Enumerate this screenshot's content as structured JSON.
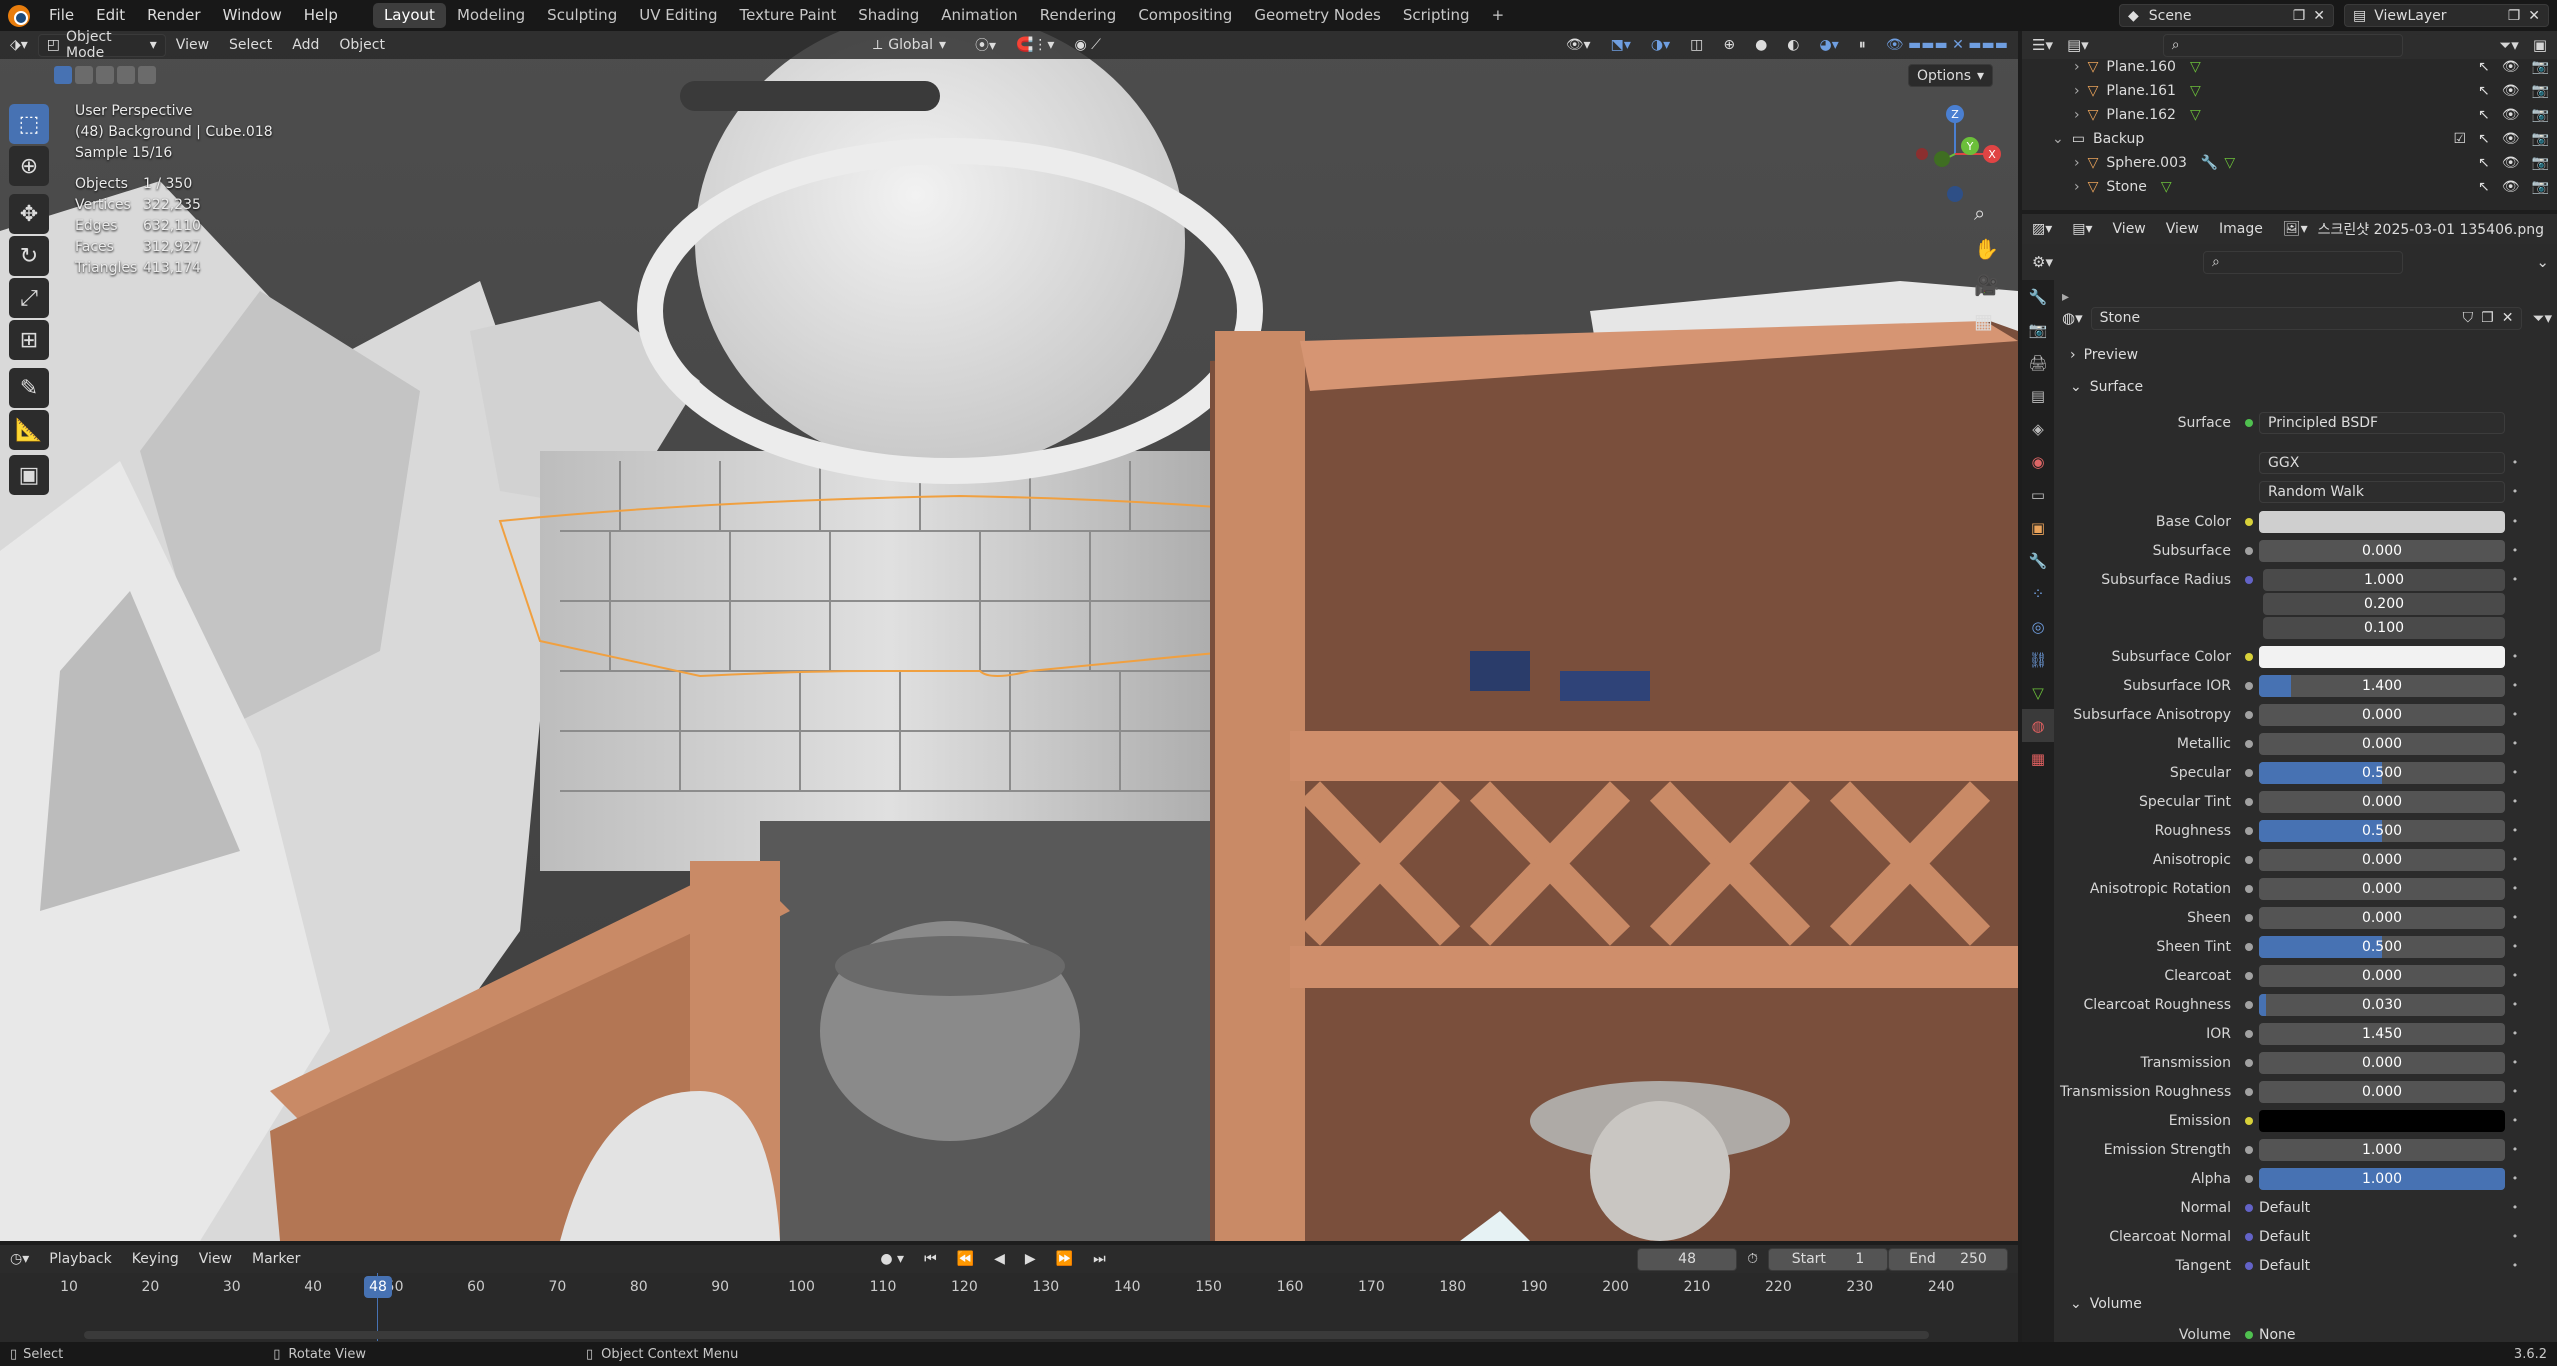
{
  "menubar": {
    "menus": [
      "File",
      "Edit",
      "Render",
      "Window",
      "Help"
    ],
    "workspaces": [
      "Layout",
      "Modeling",
      "Sculpting",
      "UV Editing",
      "Texture Paint",
      "Shading",
      "Animation",
      "Rendering",
      "Compositing",
      "Geometry Nodes",
      "Scripting"
    ],
    "active_workspace": "Layout",
    "add_tab": "+",
    "scene": "Scene",
    "view_layer": "ViewLayer"
  },
  "viewport_header": {
    "mode": "Object Mode",
    "menus": [
      "View",
      "Select",
      "Add",
      "Object"
    ],
    "transform_orientation": "Global",
    "options": "Options"
  },
  "overlay_info": {
    "view_name": "User Perspective",
    "object_info": "(48) Background | Cube.018",
    "sample": "Sample 15/16",
    "stats": [
      {
        "label": "Objects",
        "value": "1 / 350"
      },
      {
        "label": "Vertices",
        "value": "322,235"
      },
      {
        "label": "Edges",
        "value": "632,110"
      },
      {
        "label": "Faces",
        "value": "312,927"
      },
      {
        "label": "Triangles",
        "value": "413,174"
      }
    ]
  },
  "gizmo": {
    "x": "X",
    "y": "Y",
    "z": "Z"
  },
  "outliner": {
    "rows": [
      {
        "name": "Plane.160",
        "indent": 2
      },
      {
        "name": "Plane.161",
        "indent": 2
      },
      {
        "name": "Plane.162",
        "indent": 2
      },
      {
        "name": "Backup",
        "indent": 1
      },
      {
        "name": "Sphere.003",
        "indent": 2
      },
      {
        "name": "Stone",
        "indent": 2
      }
    ]
  },
  "image_editor": {
    "menus": [
      "View",
      "View",
      "Image"
    ],
    "image_name": "스크린샷 2025-03-01 135406.png"
  },
  "properties": {
    "material_name": "Stone",
    "sections": {
      "preview": "Preview",
      "surface": "Surface",
      "volume": "Volume"
    },
    "surface_label": "Surface",
    "surface_shader": "Principled BSDF",
    "distribution": "GGX",
    "subsurface_method": "Random Walk",
    "rows": [
      {
        "label": "Base Color",
        "value": "",
        "type": "color",
        "color": "#cfcfcf",
        "socket": "#d8d13a"
      },
      {
        "label": "Subsurface",
        "value": "0.000",
        "type": "num",
        "fill": 0,
        "socket": "#a1a1a1"
      },
      {
        "label": "Subsurface Radius",
        "value": "1.000",
        "type": "num",
        "fill": 0,
        "socket": "#6363c7"
      },
      {
        "label": "",
        "value": "0.200",
        "type": "num",
        "fill": 0,
        "socket": ""
      },
      {
        "label": "",
        "value": "0.100",
        "type": "num",
        "fill": 0,
        "socket": ""
      },
      {
        "label": "Subsurface Color",
        "value": "",
        "type": "color",
        "color": "#f2f2f2",
        "socket": "#d8d13a"
      },
      {
        "label": "Subsurface IOR",
        "value": "1.400",
        "type": "num",
        "fill": 0.13,
        "socket": "#a1a1a1"
      },
      {
        "label": "Subsurface Anisotropy",
        "value": "0.000",
        "type": "num",
        "fill": 0,
        "socket": "#a1a1a1"
      },
      {
        "label": "Metallic",
        "value": "0.000",
        "type": "num",
        "fill": 0,
        "socket": "#a1a1a1"
      },
      {
        "label": "Specular",
        "value": "0.500",
        "type": "num",
        "fill": 0.5,
        "socket": "#a1a1a1"
      },
      {
        "label": "Specular Tint",
        "value": "0.000",
        "type": "num",
        "fill": 0,
        "socket": "#a1a1a1"
      },
      {
        "label": "Roughness",
        "value": "0.500",
        "type": "num",
        "fill": 0.5,
        "socket": "#a1a1a1"
      },
      {
        "label": "Anisotropic",
        "value": "0.000",
        "type": "num",
        "fill": 0,
        "socket": "#a1a1a1"
      },
      {
        "label": "Anisotropic Rotation",
        "value": "0.000",
        "type": "num",
        "fill": 0,
        "socket": "#a1a1a1"
      },
      {
        "label": "Sheen",
        "value": "0.000",
        "type": "num",
        "fill": 0,
        "socket": "#a1a1a1"
      },
      {
        "label": "Sheen Tint",
        "value": "0.500",
        "type": "num",
        "fill": 0.5,
        "socket": "#a1a1a1"
      },
      {
        "label": "Clearcoat",
        "value": "0.000",
        "type": "num",
        "fill": 0,
        "socket": "#a1a1a1"
      },
      {
        "label": "Clearcoat Roughness",
        "value": "0.030",
        "type": "num",
        "fill": 0.03,
        "socket": "#a1a1a1"
      },
      {
        "label": "IOR",
        "value": "1.450",
        "type": "num",
        "fill": 0,
        "socket": "#a1a1a1"
      },
      {
        "label": "Transmission",
        "value": "0.000",
        "type": "num",
        "fill": 0,
        "socket": "#a1a1a1"
      },
      {
        "label": "Transmission Roughness",
        "value": "0.000",
        "type": "num",
        "fill": 0,
        "socket": "#a1a1a1"
      },
      {
        "label": "Emission",
        "value": "",
        "type": "color",
        "color": "#000000",
        "socket": "#d8d13a"
      },
      {
        "label": "Emission Strength",
        "value": "1.000",
        "type": "num",
        "fill": 0,
        "socket": "#a1a1a1"
      },
      {
        "label": "Alpha",
        "value": "1.000",
        "type": "num",
        "fill": 1.0,
        "socket": "#a1a1a1"
      },
      {
        "label": "Normal",
        "value": "Default",
        "type": "link",
        "socket": "#6363c7"
      },
      {
        "label": "Clearcoat Normal",
        "value": "Default",
        "type": "link",
        "socket": "#6363c7"
      },
      {
        "label": "Tangent",
        "value": "Default",
        "type": "link",
        "socket": "#6363c7"
      }
    ],
    "volume_label": "Volume",
    "volume_value": "None"
  },
  "timeline": {
    "menus": [
      "Playback",
      "Keying",
      "View",
      "Marker"
    ],
    "current_frame": "48",
    "start_label": "Start",
    "start": "1",
    "end_label": "End",
    "end": "250",
    "ticks": [
      "10",
      "20",
      "30",
      "40",
      "50",
      "60",
      "70",
      "80",
      "90",
      "100",
      "110",
      "120",
      "130",
      "140",
      "150",
      "160",
      "170",
      "180",
      "190",
      "200",
      "210",
      "220",
      "230",
      "240"
    ]
  },
  "statusbar": {
    "select": "Select",
    "rotate": "Rotate View",
    "context": "Object Context Menu",
    "version": "3.6.2"
  },
  "colors": {
    "accent": "#4772b3",
    "selection_outline": "#f0a040",
    "wood": "#c98a66"
  }
}
